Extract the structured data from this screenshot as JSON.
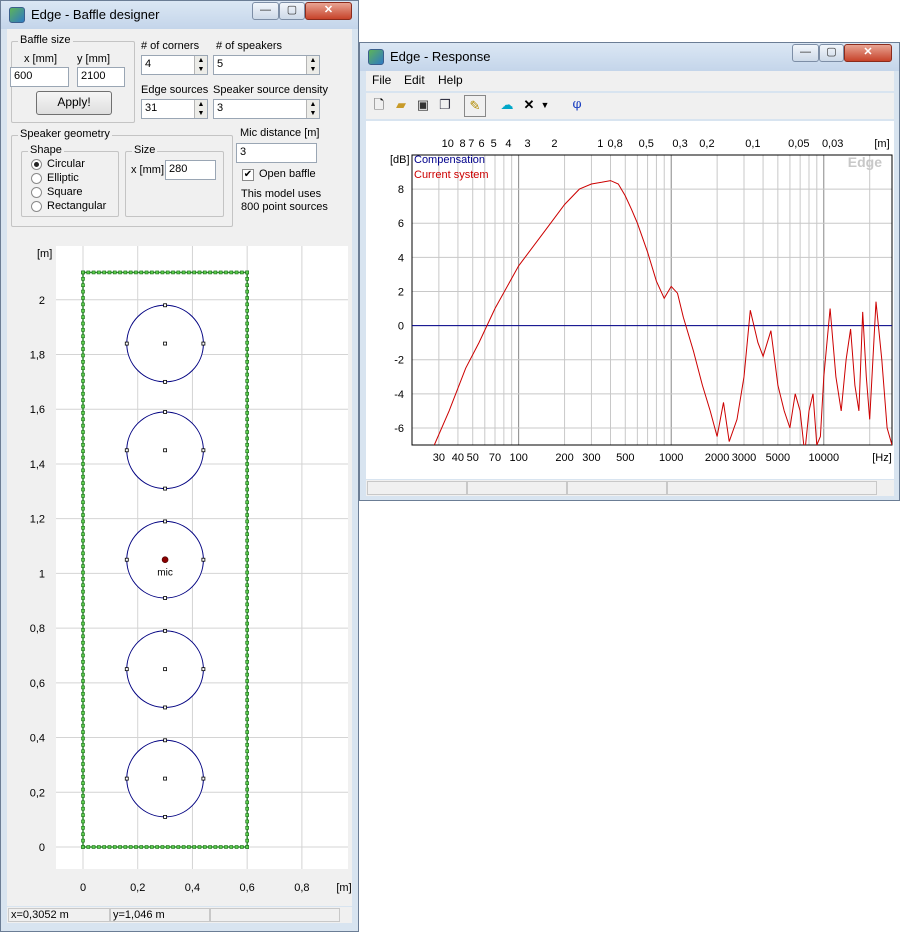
{
  "baffle_window": {
    "title": "Edge - Baffle designer",
    "baffle_size_label": "Baffle size",
    "x_label": "x [mm]",
    "y_label": "y [mm]",
    "x_value": "600",
    "y_value": "2100",
    "apply_label": "Apply!",
    "corners_label": "# of corners",
    "corners_value": "4",
    "speakers_label": "# of speakers",
    "speakers_value": "5",
    "edge_sources_label": "Edge sources",
    "edge_sources_value": "31",
    "density_label": "Speaker source density",
    "density_value": "3",
    "geometry_label": "Speaker geometry",
    "shape_label": "Shape",
    "shapes": [
      "Circular",
      "Elliptic",
      "Square",
      "Rectangular"
    ],
    "selected_shape": "Circular",
    "size_label": "Size",
    "size_x_label": "x [mm]",
    "size_x_value": "280",
    "mic_distance_label": "Mic distance [m]",
    "mic_distance_value": "3",
    "open_baffle_label": "Open baffle",
    "open_baffle_checked": true,
    "model_info_line1": "This model uses",
    "model_info_line2": "800 point sources",
    "plot": {
      "unit_label": "[m]",
      "y_ticks": [
        "2",
        "1,8",
        "1,6",
        "1,4",
        "1,2",
        "1",
        "0,8",
        "0,6",
        "0,4",
        "0,2",
        "0"
      ],
      "x_ticks": [
        "0",
        "0,2",
        "0,4",
        "0,6",
        "0,8",
        "[m]"
      ],
      "mic_label": "mic",
      "baffle_width_m": 0.6,
      "baffle_height_m": 2.1,
      "speaker_centers_y_m": [
        0.25,
        0.65,
        1.05,
        1.45,
        1.84
      ],
      "speaker_center_x_m": 0.3,
      "speaker_radius_m": 0.14,
      "mic_position_m": [
        0.3,
        1.05
      ]
    },
    "status_x": "x=0,3052 m",
    "status_y": "y=1,046 m"
  },
  "response_window": {
    "title": "Edge - Response",
    "menu": [
      "File",
      "Edit",
      "Help"
    ],
    "toolbar_phase_label": "φ"
  },
  "chart_data": {
    "type": "line",
    "title": "",
    "ylabel": "[dB]",
    "xlabel": "[Hz]",
    "x_scale": "log",
    "xlim": [
      20,
      28000
    ],
    "ylim": [
      -7,
      10
    ],
    "y_ticks": [
      "8",
      "6",
      "4",
      "2",
      "0",
      "-2",
      "-4",
      "-6"
    ],
    "x_ticks": [
      "30",
      "40",
      "50",
      "70",
      "100",
      "200",
      "300",
      "500",
      "1000",
      "2000",
      "3000",
      "5000",
      "10000"
    ],
    "x_unit_label": "[Hz]",
    "top_ticks": [
      "10",
      "8",
      "7",
      "6",
      "5",
      "4",
      "3",
      "2",
      "1",
      "0,8",
      "0,5",
      "0,3",
      "0,2",
      "0,1",
      "0,05",
      "0,03"
    ],
    "top_unit_label": "[m]",
    "watermark": "Edge",
    "legend": [
      "Compensation",
      "Current system"
    ],
    "series": [
      {
        "name": "Compensation",
        "color": "#00008b",
        "x": [
          20,
          28000
        ],
        "y": [
          0,
          0
        ]
      },
      {
        "name": "Current system",
        "color": "#cc0000",
        "x": [
          28,
          35,
          45,
          55,
          70,
          100,
          150,
          200,
          250,
          300,
          350,
          400,
          450,
          500,
          550,
          600,
          700,
          800,
          900,
          1000,
          1100,
          1200,
          1400,
          1600,
          1800,
          2000,
          2200,
          2400,
          2700,
          3000,
          3300,
          3700,
          4000,
          4500,
          5000,
          5500,
          6000,
          6500,
          7000,
          7500,
          8000,
          8500,
          9000,
          9500,
          10000,
          11000,
          12000,
          13000,
          14000,
          15000,
          16000,
          17000,
          18000,
          19000,
          20000,
          22000,
          24000,
          26000,
          28000
        ],
        "y": [
          -7,
          -5,
          -2.5,
          -1,
          1,
          3.5,
          5.6,
          7.1,
          8.0,
          8.3,
          8.4,
          8.5,
          8.3,
          7.6,
          6.8,
          6.0,
          4.3,
          2.6,
          1.6,
          2.3,
          1.9,
          0.5,
          -1.5,
          -3.5,
          -5,
          -6.5,
          -4.5,
          -6.8,
          -5.5,
          -3,
          0.9,
          -1,
          -1.8,
          -0.3,
          -3.5,
          -5,
          -6,
          -4,
          -5,
          -7.5,
          -5,
          -4,
          -7,
          -6.5,
          -3,
          1,
          -3,
          -5,
          -2,
          -0.2,
          -3.5,
          -5,
          0.8,
          -3,
          -5.5,
          1.4,
          -2,
          -6,
          -7
        ]
      }
    ]
  }
}
